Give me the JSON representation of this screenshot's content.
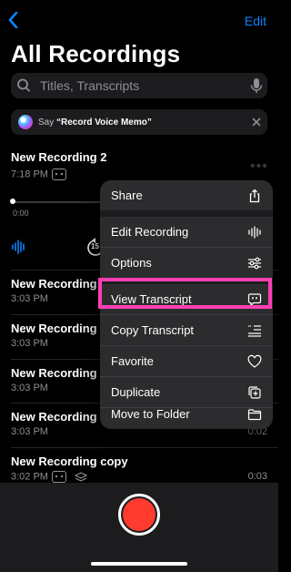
{
  "header": {
    "edit_label": "Edit",
    "title": "All Recordings"
  },
  "search": {
    "placeholder": "Titles, Transcripts"
  },
  "siri": {
    "say": "Say",
    "phrase": "“Record Voice Memo”"
  },
  "expanded": {
    "title": "New Recording 2",
    "time": "7:18 PM",
    "elapsed": "0:00",
    "skip_label": "15"
  },
  "recordings": [
    {
      "title": "New Recording",
      "time": "3:03 PM",
      "duration": ""
    },
    {
      "title": "New Recording c",
      "time": "3:03 PM",
      "duration": ""
    },
    {
      "title": "New Recording c",
      "time": "3:03 PM",
      "duration": ""
    },
    {
      "title": "New Recording c",
      "time": "3:03 PM",
      "duration": "0:02"
    },
    {
      "title": "New Recording copy",
      "time": "3:02 PM",
      "duration": "0:03"
    }
  ],
  "menu": {
    "items": [
      {
        "label": "Share",
        "icon": "share-icon"
      },
      {
        "label": "Edit Recording",
        "icon": "waveform-icon"
      },
      {
        "label": "Options",
        "icon": "sliders-icon"
      },
      {
        "label": "View Transcript",
        "icon": "transcript-bubble-icon"
      },
      {
        "label": "Copy Transcript",
        "icon": "quote-icon"
      },
      {
        "label": "Favorite",
        "icon": "heart-icon"
      },
      {
        "label": "Duplicate",
        "icon": "duplicate-icon"
      },
      {
        "label": "Move to Folder",
        "icon": "folder-icon"
      }
    ]
  },
  "colors": {
    "accent": "#0a84ff",
    "record": "#ff3b30",
    "highlight": "#ff3fb4",
    "menu_bg": "#2c2c2e"
  }
}
